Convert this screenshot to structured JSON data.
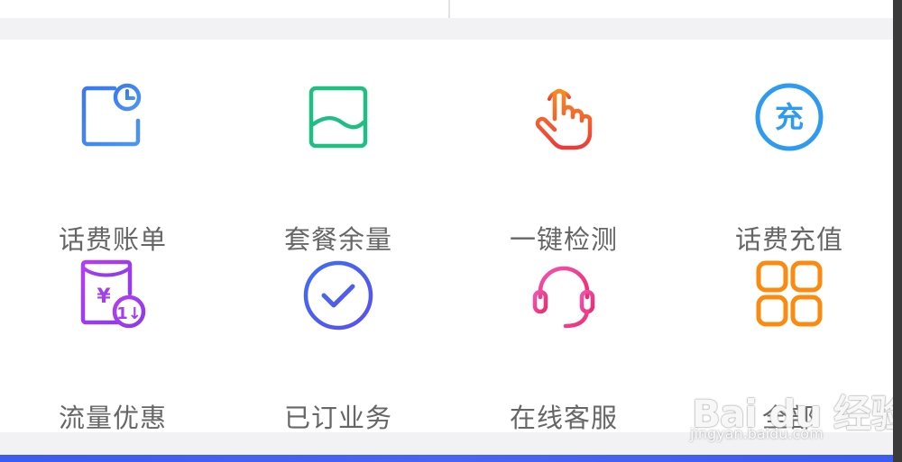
{
  "services": [
    {
      "label": "话费账单",
      "icon": "bill-icon",
      "color": "#3f86ee"
    },
    {
      "label": "套餐余量",
      "icon": "package-balance-icon",
      "color": "#1fbe83"
    },
    {
      "label": "一键检测",
      "icon": "tap-finger-icon",
      "color": "#f25c3a"
    },
    {
      "label": "话费充值",
      "icon": "recharge-icon",
      "color": "#2e9af0"
    },
    {
      "label": "流量优惠",
      "icon": "data-discount-icon",
      "color": "#a23ff0"
    },
    {
      "label": "已订业务",
      "icon": "subscribed-check-icon",
      "color": "#4a5ff0"
    },
    {
      "label": "在线客服",
      "icon": "headset-icon",
      "color": "#f0308a"
    },
    {
      "label": "全部",
      "icon": "all-grid-icon",
      "color": "#fb8a11"
    }
  ],
  "recharge_glyph": "充",
  "discount_yen": "¥",
  "discount_badge": "1↓",
  "watermark": {
    "logo": "Bai du 经验",
    "url": "jingyan.baidu.com"
  }
}
